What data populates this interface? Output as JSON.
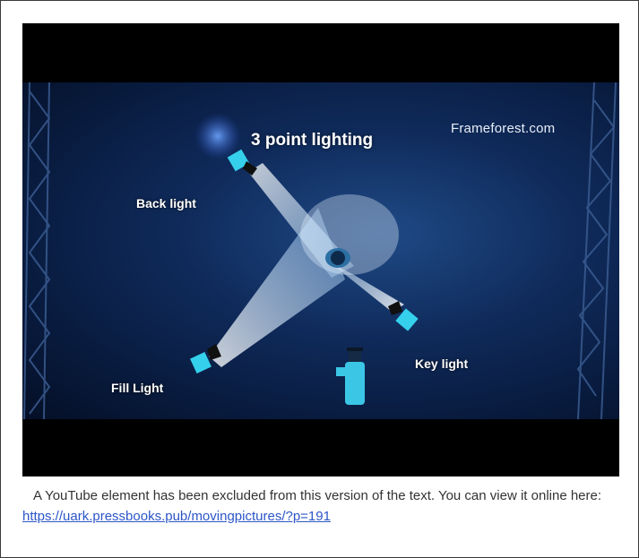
{
  "video": {
    "title": "3 point lighting",
    "brand": "Frameforest.com",
    "labels": {
      "back": "Back light",
      "key": "Key light",
      "fill": "Fill Light"
    }
  },
  "caption": {
    "text": "A YouTube element has been excluded from this version of the text. You can view it online here: ",
    "link_text": "https://uark.pressbooks.pub/movingpictures/?p=191"
  },
  "colors": {
    "frame_bg": "#0f2a5a",
    "light_fixture": "#35d0ec",
    "link": "#2c56c8"
  }
}
